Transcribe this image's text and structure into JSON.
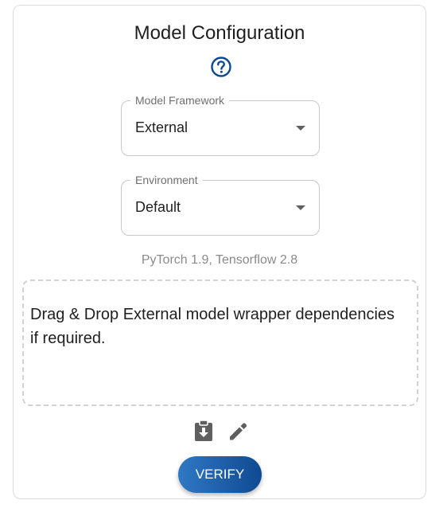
{
  "panel": {
    "title": "Model Configuration",
    "help_icon": "help-circle-icon"
  },
  "framework_select": {
    "label": "Model Framework",
    "value": "External"
  },
  "environment_select": {
    "label": "Environment",
    "value": "Default"
  },
  "environment_info": "PyTorch 1.9, Tensorflow 2.8",
  "dropzone": {
    "text": "Drag & Drop External model wrapper dependencies if required."
  },
  "actions": {
    "download_icon": "clipboard-download-icon",
    "edit_icon": "pencil-icon",
    "verify_label": "VERIFY"
  },
  "colors": {
    "accent": "#0f4a91",
    "accent_light": "#2f78c5",
    "icon_gray": "#5f5f5f"
  }
}
